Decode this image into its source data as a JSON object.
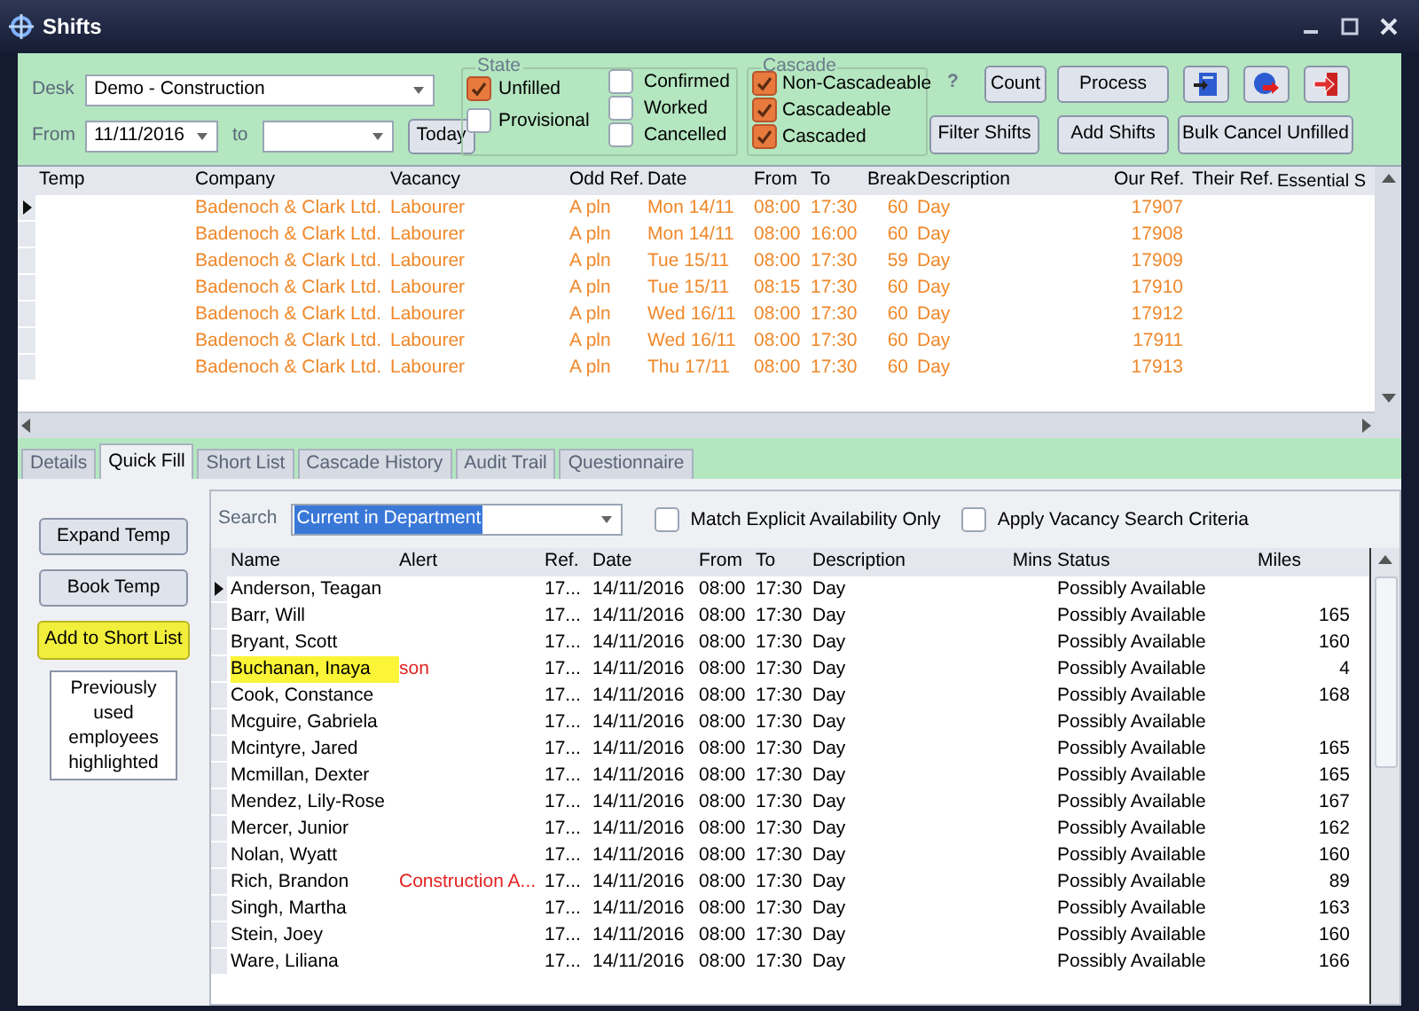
{
  "window": {
    "title": "Shifts"
  },
  "filters": {
    "desk": {
      "label": "Desk",
      "value": "Demo - Construction"
    },
    "from": {
      "label": "From",
      "value": "11/11/2016"
    },
    "to": {
      "label": "to"
    },
    "today_button": "Today"
  },
  "state": {
    "title": "State",
    "options": [
      {
        "label": "Unfilled",
        "checked": true
      },
      {
        "label": "Provisional",
        "checked": false
      },
      {
        "label": "Confirmed",
        "checked": false
      },
      {
        "label": "Worked",
        "checked": false
      },
      {
        "label": "Cancelled",
        "checked": false
      }
    ]
  },
  "cascade": {
    "title": "Cascade",
    "options": [
      {
        "label": "Non-Cascadeable",
        "checked": true
      },
      {
        "label": "Cascadeable",
        "checked": true
      },
      {
        "label": "Cascaded",
        "checked": true
      }
    ]
  },
  "help": "?",
  "buttons": [
    "Count",
    "Process",
    "Filter Shifts",
    "Add Shifts",
    "Bulk Cancel Unfilled"
  ],
  "shifts_table": {
    "columns": [
      "Temp",
      "Company",
      "Vacancy",
      "Odd Ref.",
      "Date",
      "From",
      "To",
      "Break",
      "Description",
      "Our Ref.",
      "Their Ref.",
      "Essential S"
    ],
    "rows": [
      {
        "selected": true,
        "cells": [
          "",
          "Badenoch & Clark Ltd.",
          "Labourer",
          "A pln",
          "Mon 14/11",
          "08:00",
          "17:30",
          "60",
          "Day",
          "17907",
          "",
          ""
        ]
      },
      {
        "selected": false,
        "cells": [
          "",
          "Badenoch & Clark Ltd.",
          "Labourer",
          "A pln",
          "Mon 14/11",
          "08:00",
          "16:00",
          "60",
          "Day",
          "17908",
          "",
          ""
        ]
      },
      {
        "selected": false,
        "cells": [
          "",
          "Badenoch & Clark Ltd.",
          "Labourer",
          "A pln",
          "Tue 15/11",
          "08:00",
          "17:30",
          "59",
          "Day",
          "17909",
          "",
          ""
        ]
      },
      {
        "selected": false,
        "cells": [
          "",
          "Badenoch & Clark Ltd.",
          "Labourer",
          "A pln",
          "Tue 15/11",
          "08:15",
          "17:30",
          "60",
          "Day",
          "17910",
          "",
          ""
        ]
      },
      {
        "selected": false,
        "cells": [
          "",
          "Badenoch & Clark Ltd.",
          "Labourer",
          "A pln",
          "Wed 16/11",
          "08:00",
          "17:30",
          "60",
          "Day",
          "17912",
          "",
          ""
        ]
      },
      {
        "selected": false,
        "cells": [
          "",
          "Badenoch & Clark Ltd.",
          "Labourer",
          "A pln",
          "Wed 16/11",
          "08:00",
          "17:30",
          "60",
          "Day",
          "17911",
          "",
          ""
        ]
      },
      {
        "selected": false,
        "cells": [
          "",
          "Badenoch & Clark Ltd.",
          "Labourer",
          "A pln",
          "Thu 17/11",
          "08:00",
          "17:30",
          "60",
          "Day",
          "17913",
          "",
          ""
        ]
      }
    ]
  },
  "tabs": [
    {
      "label": "Details",
      "selected": false
    },
    {
      "label": "Quick Fill",
      "selected": true
    },
    {
      "label": "Short List",
      "selected": false
    },
    {
      "label": "Cascade History",
      "selected": false
    },
    {
      "label": "Audit Trail",
      "selected": false
    },
    {
      "label": "Questionnaire",
      "selected": false
    }
  ],
  "side_buttons": [
    {
      "label": "Expand Temp",
      "kind": "normal"
    },
    {
      "label": "Book Temp",
      "kind": "normal"
    },
    {
      "label": "Add to Short List",
      "kind": "highlighted"
    }
  ],
  "note": "Previously used employees highlighted",
  "search": {
    "label": "Search",
    "value": "Current in Department"
  },
  "search_options": [
    {
      "label": "Match Explicit Availability Only",
      "checked": false
    },
    {
      "label": "Apply Vacancy Search Criteria",
      "checked": false
    }
  ],
  "candidates_table": {
    "columns": [
      "Name",
      "Alert",
      "Ref.",
      "Date",
      "From",
      "To",
      "Description",
      "Mins",
      "Status",
      "Miles"
    ],
    "rows": [
      {
        "selected": true,
        "highlighted": false,
        "cells": [
          "Anderson, Teagan",
          "",
          "17...",
          "14/11/2016",
          "08:00",
          "17:30",
          "Day",
          "",
          "Possibly Available",
          ""
        ]
      },
      {
        "selected": false,
        "highlighted": false,
        "cells": [
          "Barr, Will",
          "",
          "17...",
          "14/11/2016",
          "08:00",
          "17:30",
          "Day",
          "",
          "Possibly Available",
          "165"
        ]
      },
      {
        "selected": false,
        "highlighted": false,
        "cells": [
          "Bryant, Scott",
          "",
          "17...",
          "14/11/2016",
          "08:00",
          "17:30",
          "Day",
          "",
          "Possibly Available",
          "160"
        ]
      },
      {
        "selected": false,
        "highlighted": true,
        "cells": [
          "Buchanan, Inaya",
          "son",
          "17...",
          "14/11/2016",
          "08:00",
          "17:30",
          "Day",
          "",
          "Possibly Available",
          "4"
        ]
      },
      {
        "selected": false,
        "highlighted": false,
        "cells": [
          "Cook, Constance",
          "",
          "17...",
          "14/11/2016",
          "08:00",
          "17:30",
          "Day",
          "",
          "Possibly Available",
          "168"
        ]
      },
      {
        "selected": false,
        "highlighted": false,
        "cells": [
          "Mcguire, Gabriela",
          "",
          "17...",
          "14/11/2016",
          "08:00",
          "17:30",
          "Day",
          "",
          "Possibly Available",
          ""
        ]
      },
      {
        "selected": false,
        "highlighted": false,
        "cells": [
          "Mcintyre, Jared",
          "",
          "17...",
          "14/11/2016",
          "08:00",
          "17:30",
          "Day",
          "",
          "Possibly Available",
          "165"
        ]
      },
      {
        "selected": false,
        "highlighted": false,
        "cells": [
          "Mcmillan, Dexter",
          "",
          "17...",
          "14/11/2016",
          "08:00",
          "17:30",
          "Day",
          "",
          "Possibly Available",
          "165"
        ]
      },
      {
        "selected": false,
        "highlighted": false,
        "cells": [
          "Mendez, Lily-Rose",
          "",
          "17...",
          "14/11/2016",
          "08:00",
          "17:30",
          "Day",
          "",
          "Possibly Available",
          "167"
        ]
      },
      {
        "selected": false,
        "highlighted": false,
        "cells": [
          "Mercer, Junior",
          "",
          "17...",
          "14/11/2016",
          "08:00",
          "17:30",
          "Day",
          "",
          "Possibly Available",
          "162"
        ]
      },
      {
        "selected": false,
        "highlighted": false,
        "cells": [
          "Nolan, Wyatt",
          "",
          "17...",
          "14/11/2016",
          "08:00",
          "17:30",
          "Day",
          "",
          "Possibly Available",
          "160"
        ]
      },
      {
        "selected": false,
        "highlighted": false,
        "cells": [
          "Rich, Brandon",
          "Construction A...",
          "17...",
          "14/11/2016",
          "08:00",
          "17:30",
          "Day",
          "",
          "Possibly Available",
          "89"
        ]
      },
      {
        "selected": false,
        "highlighted": false,
        "cells": [
          "Singh, Martha",
          "",
          "17...",
          "14/11/2016",
          "08:00",
          "17:30",
          "Day",
          "",
          "Possibly Available",
          "163"
        ]
      },
      {
        "selected": false,
        "highlighted": false,
        "cells": [
          "Stein, Joey",
          "",
          "17...",
          "14/11/2016",
          "08:00",
          "17:30",
          "Day",
          "",
          "Possibly Available",
          "160"
        ]
      },
      {
        "selected": false,
        "highlighted": false,
        "cells": [
          "Ware, Liliana",
          "",
          "17...",
          "14/11/2016",
          "08:00",
          "17:30",
          "Day",
          "",
          "Possibly Available",
          "166"
        ]
      }
    ]
  }
}
